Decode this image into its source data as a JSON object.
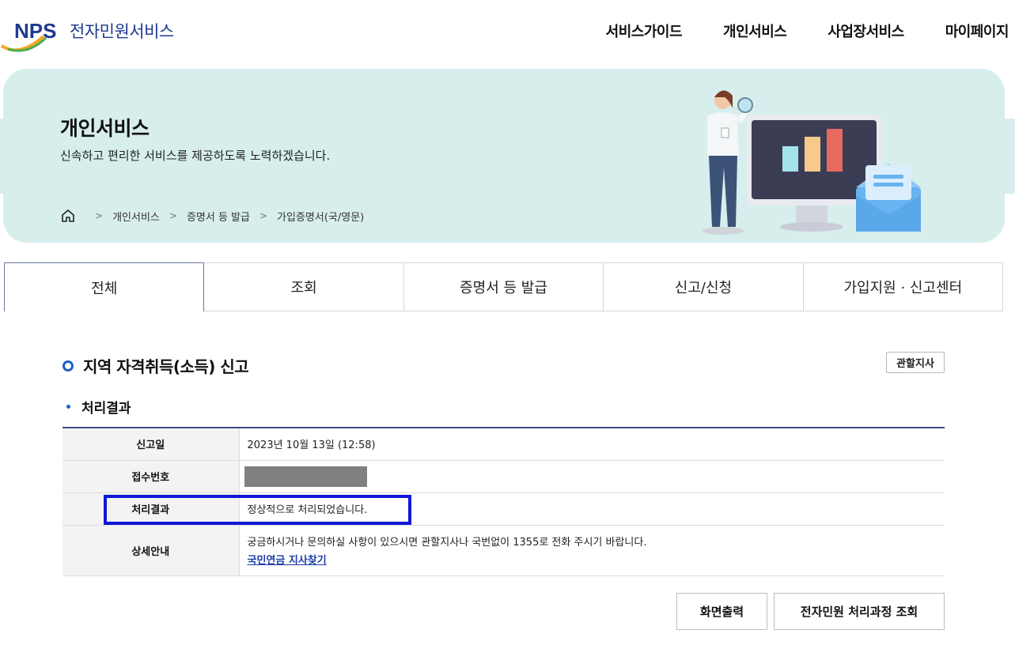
{
  "header": {
    "logo_mark": "NPS",
    "logo_text": "전자민원서비스",
    "nav": [
      "서비스가이드",
      "개인서비스",
      "사업장서비스",
      "마이페이지"
    ]
  },
  "banner": {
    "title": "개인서비스",
    "description": "신속하고 편리한 서비스를 제공하도록 노력하겠습니다.",
    "breadcrumb": [
      "개인서비스",
      "증명서 등 발급",
      "가입증명서(국/영문)"
    ]
  },
  "tabs": [
    "전체",
    "조회",
    "증명서 등 발급",
    "신고/신청",
    "가입지원 · 신고센터"
  ],
  "section": {
    "title": "지역 자격취득(소득) 신고",
    "jurisdiction_button": "관할지사",
    "subtitle": "처리결과"
  },
  "result_table": {
    "rows": [
      {
        "label": "신고일",
        "value": "2023년 10월 13일 (12:58)"
      },
      {
        "label": "접수번호",
        "value": ""
      },
      {
        "label": "처리결과",
        "value": "정상적으로 처리되었습니다."
      },
      {
        "label": "상세안내",
        "value": "궁금하시거나 문의하실 사항이 있으시면 관할지사나 국번없이 1355로 전화 주시기 바랍니다.",
        "link": "국민연금 지사찾기"
      }
    ]
  },
  "buttons": {
    "print": "화면출력",
    "process": "전자민원 처리과정 조회"
  },
  "colors": {
    "brand_blue": "#1f3a8f",
    "banner_bg": "#d7eeed",
    "accent_blue": "#1b62c4",
    "highlight": "#1017d8"
  }
}
